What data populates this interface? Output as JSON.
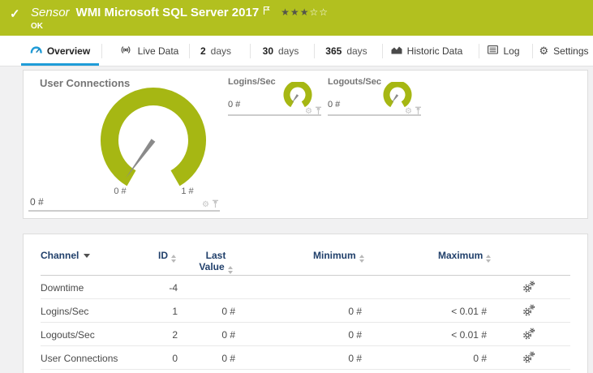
{
  "header": {
    "check": "✓",
    "kind": "Sensor",
    "title": "WMI Microsoft SQL Server 2017",
    "status": "OK",
    "stars_filled": "★★★",
    "stars_empty": "☆☆"
  },
  "tabs": {
    "overview": "Overview",
    "live_data": "Live Data",
    "days2_num": "2",
    "days2_label": "days",
    "days30_num": "30",
    "days30_label": "days",
    "days365_num": "365",
    "days365_label": "days",
    "historic_data": "Historic Data",
    "log": "Log",
    "settings": "Settings",
    "settings_gear": "⚙"
  },
  "gauges": {
    "user_connections": {
      "title": "User Connections",
      "value": "0 #",
      "scale_min": "0 #",
      "scale_max": "1 #",
      "gear": "⚙"
    },
    "logins_sec": {
      "title": "Logins/Sec",
      "value": "0 #",
      "gear": "⚙"
    },
    "logouts_sec": {
      "title": "Logouts/Sec",
      "value": "0 #",
      "gear": "⚙"
    }
  },
  "table": {
    "headers": {
      "channel": "Channel",
      "id": "ID",
      "last_line1": "Last",
      "last_line2": "Value",
      "minimum": "Minimum",
      "maximum": "Maximum"
    },
    "rows": [
      {
        "channel": "Downtime",
        "id": "-4",
        "last": "",
        "min": "",
        "max": ""
      },
      {
        "channel": "Logins/Sec",
        "id": "1",
        "last": "0 #",
        "min": "0 #",
        "max": "< 0.01 #"
      },
      {
        "channel": "Logouts/Sec",
        "id": "2",
        "last": "0 #",
        "min": "0 #",
        "max": "< 0.01 #"
      },
      {
        "channel": "User Connections",
        "id": "0",
        "last": "0 #",
        "min": "0 #",
        "max": "0 #"
      }
    ]
  },
  "colors": {
    "status_green": "#b2c01f",
    "gauge_green": "#a6b713",
    "accent_blue": "#1f9cd8",
    "table_header_navy": "#21406b"
  }
}
